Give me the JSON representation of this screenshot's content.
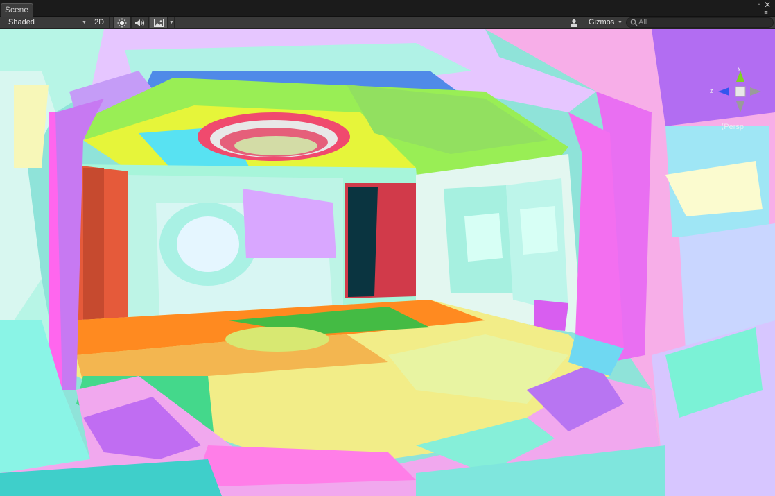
{
  "tab": {
    "label": "Scene"
  },
  "window_controls": {
    "maximize": "▫",
    "menu": "≡"
  },
  "toolbar": {
    "draw_mode": "Shaded",
    "mode_2d": "2D",
    "gizmos_label": "Gizmos",
    "search_placeholder": "All"
  },
  "icons": {
    "lighting": "sun-icon",
    "audio": "speaker-icon",
    "effects": "image-icon",
    "search": "search-icon",
    "layers": "person-icon"
  },
  "gizmo": {
    "y_label": "y",
    "z_label": "z",
    "projection": "Persp"
  },
  "colors": {
    "toolbar_bg": "#3a3a3a",
    "tabbar_bg": "#1b1b1b",
    "active_button": "#555555"
  }
}
